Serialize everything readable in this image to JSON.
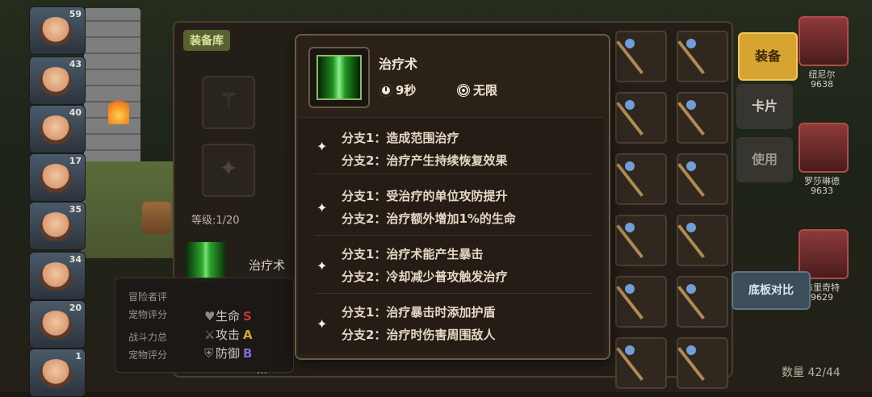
{
  "colors": {
    "accent_gold": "#d8a431",
    "tooltip_bg": "#2a2119",
    "text_light": "#e4d8c4"
  },
  "left_heroes": [
    {
      "level": "59"
    },
    {
      "level": "43"
    },
    {
      "level": "40"
    },
    {
      "level": "17"
    },
    {
      "level": "35"
    },
    {
      "level": "34"
    },
    {
      "level": "20"
    },
    {
      "level": "1"
    }
  ],
  "panel": {
    "tab": "装备库",
    "level": "等级:1/20",
    "skill_name": "治疗术",
    "hint": "…",
    "stats_lines": [
      "冒险者评",
      "宠物评分",
      "战斗力总",
      "宠物评分"
    ],
    "stats": [
      {
        "icon": "heart-icon",
        "label": "生命",
        "grade": "S",
        "color": "#c0392b"
      },
      {
        "icon": "sword-icon",
        "label": "攻击",
        "grade": "A",
        "color": "#d8a431"
      },
      {
        "icon": "shield-icon",
        "label": "防御",
        "grade": "B",
        "color": "#7a6fd8"
      }
    ]
  },
  "side_buttons": {
    "equip": "装备",
    "card": "卡片",
    "use": "使用",
    "compare": "底板对比"
  },
  "right_heroes": [
    {
      "name": "纽尼尔",
      "power": "9638"
    },
    {
      "name": "罗莎琳德",
      "power": "9633"
    },
    {
      "name": "布里奇特",
      "power": "9629"
    }
  ],
  "inventory_count": "数量 42/44",
  "tooltip": {
    "title": "治疗术",
    "cooldown": "9秒",
    "range": "无限",
    "groups": [
      {
        "a": "分支1：造成范围治疗",
        "b": "分支2：治疗产生持续恢复效果"
      },
      {
        "a": "分支1：受治疗的单位攻防提升",
        "b": "分支2：治疗额外增加1%的生命"
      },
      {
        "a": "分支1：治疗术能产生暴击",
        "b": "分支2：冷却减少普攻触发治疗"
      },
      {
        "a": "分支1：治疗暴击时添加护盾",
        "b": "分支2：治疗时伤害周围敌人"
      }
    ]
  }
}
